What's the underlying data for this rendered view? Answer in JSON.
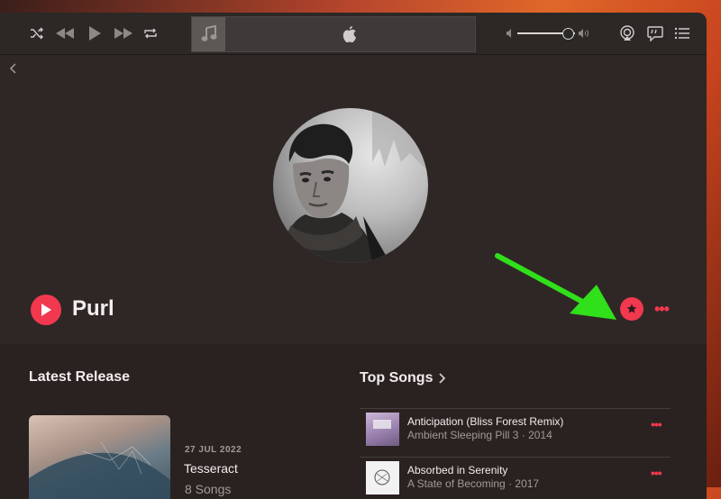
{
  "artist": {
    "name": "Purl"
  },
  "latest_release": {
    "section_title": "Latest Release",
    "date": "27 JUL 2022",
    "title": "Tesseract",
    "song_count": "8 Songs"
  },
  "top_songs": {
    "section_title": "Top Songs",
    "songs": [
      {
        "title": "Anticipation (Bliss Forest Remix)",
        "subtitle": "Ambient Sleeping Pill 3 · 2014"
      },
      {
        "title": "Absorbed in Serenity",
        "subtitle": "A State of Becoming · 2017"
      }
    ]
  },
  "icons": {
    "toolbar": [
      "shuffle-icon",
      "rewind-icon",
      "play-icon",
      "fast-forward-icon",
      "repeat-icon",
      "music-note-icon",
      "apple-logo-icon",
      "volume-low-icon",
      "volume-high-icon",
      "airplay-icon",
      "lyrics-icon",
      "queue-list-icon"
    ],
    "hero": [
      "back-chevron-icon",
      "play-icon",
      "star-icon",
      "more-icon"
    ]
  },
  "colors": {
    "accent": "#f2384f",
    "annotation_arrow": "#2fe01a"
  }
}
